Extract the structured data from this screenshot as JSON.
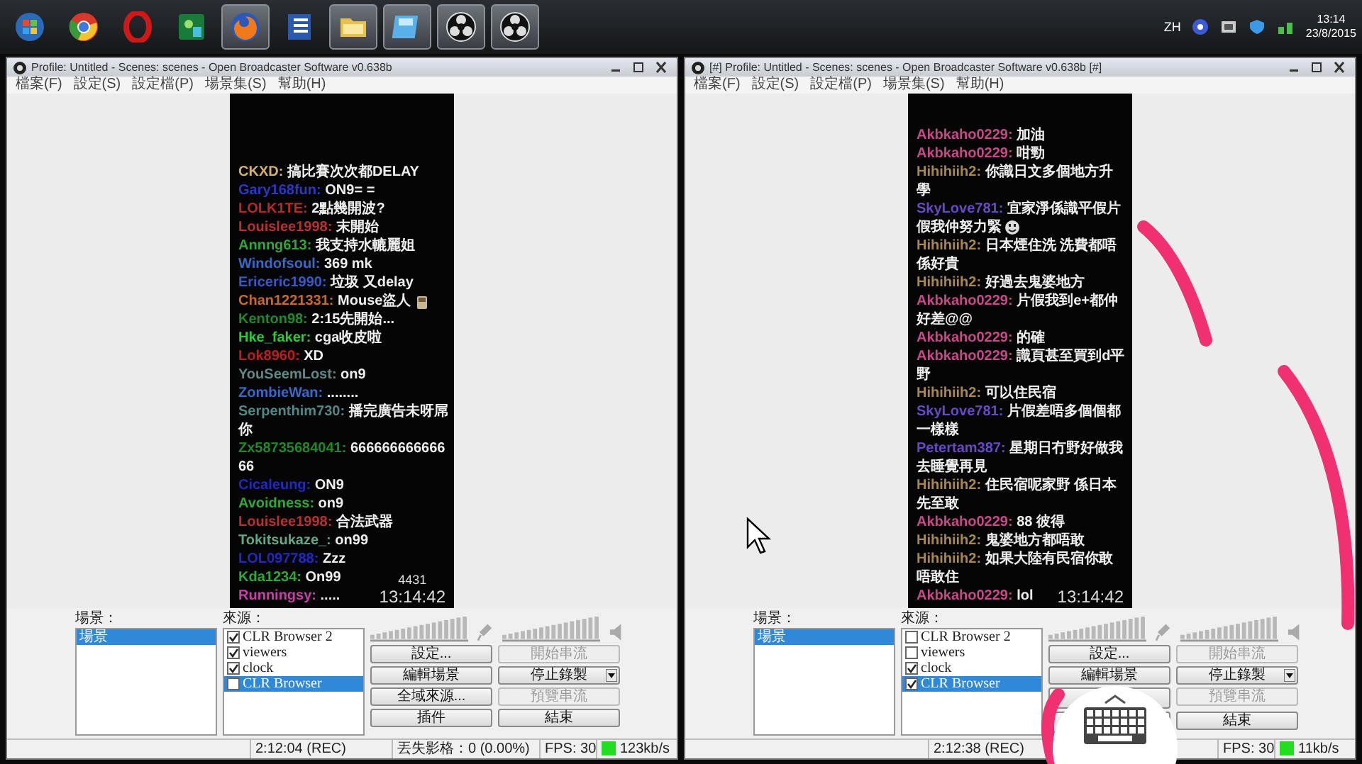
{
  "taskbar": {
    "apps": [
      {
        "kind": "start",
        "open": false
      },
      {
        "kind": "chrome",
        "open": false
      },
      {
        "kind": "opera",
        "open": false
      },
      {
        "kind": "green-app",
        "open": false
      },
      {
        "kind": "firefox",
        "open": true
      },
      {
        "kind": "word",
        "open": false
      },
      {
        "kind": "folder",
        "open": true
      },
      {
        "kind": "blue-app",
        "open": true
      },
      {
        "kind": "obs",
        "open": true
      },
      {
        "kind": "obs",
        "open": true
      }
    ],
    "tray": {
      "language": "ZH",
      "time": "13:14",
      "date": "23/8/2015"
    }
  },
  "windows": [
    {
      "title": "Profile: Untitled - Scenes: scenes - Open Broadcaster Software v0.638b",
      "menu": [
        "檔案(F)",
        "設定(S)",
        "設定檔(P)",
        "場景集(S)",
        "幫助(H)"
      ],
      "chat": {
        "messages": [
          {
            "kind": "text",
            "user": "CKXD:",
            "color": "#d4b070",
            "text": "搞比賽次次都DELAY"
          },
          {
            "kind": "text",
            "user": "Gary168fun:",
            "color": "#2838c8",
            "text": "ON9= ="
          },
          {
            "kind": "text",
            "user": "LOLK1TE:",
            "color": "#b82828",
            "text": "2點幾開波?"
          },
          {
            "kind": "text",
            "user": "Louislee1998:",
            "color": "#b83030",
            "text": "末開始"
          },
          {
            "kind": "text",
            "user": "Annng613:",
            "color": "#30a838",
            "text": "我支持水轆麗姐"
          },
          {
            "kind": "text",
            "user": "Windofsoul:",
            "color": "#3868c8",
            "text": "369 mk"
          },
          {
            "kind": "text",
            "user": "Ericeric1990:",
            "color": "#3858c8",
            "text": "垃圾 又delay"
          },
          {
            "kind": "cup-emote",
            "user": "Chan1221331:",
            "color": "#c86830",
            "text": "Mouse盜人"
          },
          {
            "kind": "text",
            "user": "Kenton98:",
            "color": "#208828",
            "text": "2:15先開始..."
          },
          {
            "kind": "text",
            "user": "Hke_faker:",
            "color": "#30c838",
            "text": "cga收皮啦"
          },
          {
            "kind": "text",
            "user": "Lok8960:",
            "color": "#b82020",
            "text": "XD"
          },
          {
            "kind": "text",
            "user": "YouSeemLost:",
            "color": "#608888",
            "text": "on9"
          },
          {
            "kind": "text",
            "user": "ZombieWan:",
            "color": "#3868c8",
            "text": "........"
          },
          {
            "kind": "text",
            "user": "Serpenthim730:",
            "color": "#508888",
            "text": "播完廣告未呀屌你"
          },
          {
            "kind": "text",
            "user": "Zx58735684041:",
            "color": "#208828",
            "text": "66666666666666"
          },
          {
            "kind": "text",
            "user": "Cicaleung:",
            "color": "#2028c8",
            "text": "ON9"
          },
          {
            "kind": "text",
            "user": "Avoidness:",
            "color": "#30a838",
            "text": "on9"
          },
          {
            "kind": "text",
            "user": "Louislee1998:",
            "color": "#b83030",
            "text": "合法武器"
          },
          {
            "kind": "text",
            "user": "Tokitsukaze_:",
            "color": "#60a888",
            "text": "on99"
          },
          {
            "kind": "text",
            "user": "LOL097788:",
            "color": "#2028c8",
            "text": "Zzz"
          },
          {
            "kind": "text",
            "user": "Kda1234:",
            "color": "#30a838",
            "text": "On99"
          },
          {
            "kind": "text",
            "user": "Runningsy:",
            "color": "#c840a8",
            "text": "....."
          }
        ],
        "count": "4431",
        "time": "13:14:42"
      },
      "scenes": {
        "label": "場景：",
        "items": [
          {
            "label": "場景",
            "selected": true
          }
        ]
      },
      "sources": {
        "label": "來源：",
        "items": [
          {
            "label": "CLR Browser 2",
            "checked": true,
            "selected": false
          },
          {
            "label": "viewers",
            "checked": true,
            "selected": false
          },
          {
            "label": "clock",
            "checked": true,
            "selected": false
          },
          {
            "label": "CLR Browser",
            "checked": false,
            "selected": true
          }
        ]
      },
      "buttons": [
        {
          "kind": "button",
          "label": "設定...",
          "disabled": false,
          "dropdown": false
        },
        {
          "kind": "button",
          "label": "開始串流",
          "disabled": true,
          "dropdown": false
        },
        {
          "kind": "button",
          "label": "編輯場景",
          "disabled": false,
          "dropdown": false
        },
        {
          "kind": "button",
          "label": "停止錄製",
          "disabled": false,
          "dropdown": true
        },
        {
          "kind": "button",
          "label": "全域來源...",
          "disabled": false,
          "dropdown": false
        },
        {
          "kind": "button",
          "label": "預覽串流",
          "disabled": true,
          "dropdown": false
        },
        {
          "kind": "button",
          "label": "插件",
          "disabled": false,
          "dropdown": false
        },
        {
          "kind": "button",
          "label": "結束",
          "disabled": false,
          "dropdown": false
        }
      ],
      "status": {
        "time": "2:12:04 (REC)",
        "dropped": "丟失影格：0 (0.00%)",
        "fps": "FPS: 30",
        "bitrate": "123kb/s"
      }
    },
    {
      "title": "[#] Profile: Untitled - Scenes: scenes - Open Broadcaster Software v0.638b [#]",
      "menu": [
        "檔案(F)",
        "設定(S)",
        "設定檔(P)",
        "場景集(S)",
        "幫助(H)"
      ],
      "chat": {
        "messages": [
          {
            "kind": "text",
            "user": "Akbkaho0229:",
            "color": "#c84888",
            "text": "加油"
          },
          {
            "kind": "text",
            "user": "Akbkaho0229:",
            "color": "#c84888",
            "text": "咁勁"
          },
          {
            "kind": "text",
            "user": "Hihihiih2:",
            "color": "#a88850",
            "text": "你識日文多個地方升學"
          },
          {
            "kind": "smile-emote",
            "user": "SkyLove781:",
            "color": "#6848c8",
            "text": "宜家淨係識平假片假我仲努力緊"
          },
          {
            "kind": "text",
            "user": "Hihihiih2:",
            "color": "#a88850",
            "text": "日本煙住洗 洗費都唔係好貴"
          },
          {
            "kind": "text",
            "user": "Hihihiih2:",
            "color": "#a88850",
            "text": "好過去鬼婆地方"
          },
          {
            "kind": "text",
            "user": "Akbkaho0229:",
            "color": "#c84888",
            "text": "片假我到e+都仲好差@@"
          },
          {
            "kind": "text",
            "user": "Akbkaho0229:",
            "color": "#c84888",
            "text": "的確"
          },
          {
            "kind": "text",
            "user": "Akbkaho0229:",
            "color": "#c84888",
            "text": "識頁甚至買到d平野"
          },
          {
            "kind": "text",
            "user": "Hihihiih2:",
            "color": "#a88850",
            "text": "可以住民宿"
          },
          {
            "kind": "text",
            "user": "SkyLove781:",
            "color": "#6848c8",
            "text": "片假差唔多個個都一樣樣"
          },
          {
            "kind": "text",
            "user": "Petertam387:",
            "color": "#6848c8",
            "text": "星期日冇野好做我去睡覺再見"
          },
          {
            "kind": "text",
            "user": "Hihihiih2:",
            "color": "#a88850",
            "text": "住民宿呢家野 係日本先至敢"
          },
          {
            "kind": "text",
            "user": "Akbkaho0229:",
            "color": "#c84888",
            "text": "88 彼得"
          },
          {
            "kind": "text",
            "user": "Hihihiih2:",
            "color": "#a88850",
            "text": "鬼婆地方都唔敢"
          },
          {
            "kind": "text",
            "user": "Hihihiih2:",
            "color": "#a88850",
            "text": "如果大陸有民宿你敢唔敢住"
          },
          {
            "kind": "text",
            "user": "Akbkaho0229:",
            "color": "#c84888",
            "text": "lol"
          }
        ],
        "time": "13:14:42"
      },
      "scenes": {
        "label": "場景：",
        "items": [
          {
            "label": "場景",
            "selected": true
          }
        ]
      },
      "sources": {
        "label": "來源：",
        "items": [
          {
            "label": "CLR Browser 2",
            "checked": false,
            "selected": false
          },
          {
            "label": "viewers",
            "checked": false,
            "selected": false
          },
          {
            "label": "clock",
            "checked": true,
            "selected": false
          },
          {
            "label": "CLR Browser",
            "checked": true,
            "selected": true
          }
        ]
      },
      "buttons": [
        {
          "kind": "button",
          "label": "設定...",
          "disabled": false,
          "dropdown": false
        },
        {
          "kind": "button",
          "label": "開始串流",
          "disabled": true,
          "dropdown": false
        },
        {
          "kind": "button",
          "label": "編輯場景",
          "disabled": false,
          "dropdown": false
        },
        {
          "kind": "button",
          "label": "停止錄製",
          "disabled": false,
          "dropdown": true
        },
        {
          "kind": "covered"
        },
        {
          "kind": "button",
          "label": "預覽串流",
          "disabled": true,
          "dropdown": false
        },
        {
          "kind": "covered"
        },
        {
          "kind": "button",
          "label": "結束",
          "disabled": false,
          "dropdown": false
        }
      ],
      "status": {
        "time": "2:12:38 (REC)",
        "fps": "FPS: 30",
        "bitrate": "11kb/s"
      }
    }
  ]
}
